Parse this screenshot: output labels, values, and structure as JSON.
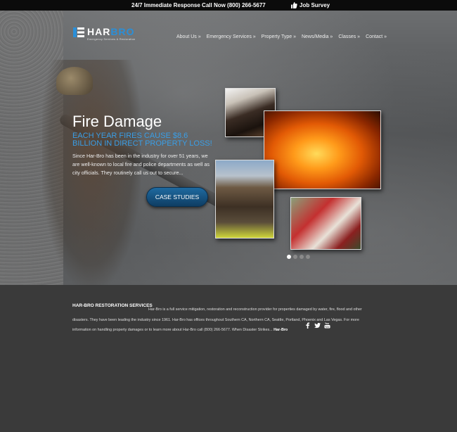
{
  "topbar": {
    "phone_text": "24/7 Immediate Response Call Now (800) 266-5677",
    "survey_label": "Job Survey",
    "survey_icon": "thumbs-up-icon"
  },
  "logo": {
    "text_a": "HAR",
    "text_b": "BRO",
    "tagline": "Emergency Services & Restoration"
  },
  "nav": {
    "items": [
      "About Us »",
      "Emergency Services »",
      "Property Type »",
      "News/Media »",
      "Classes »",
      "Contact »"
    ]
  },
  "hero": {
    "title": "Fire Damage",
    "subtitle": "EACH YEAR FIRES CAUSE $8.6 BILLION IN DIRECT PROPERTY LOSS!",
    "description": "Since Har-Bro has been in the industry for over 51 years, we are well-known to local fire and police departments as well as city officials.  They routinely call us out to secure...",
    "button_label": "CASE STUDIES",
    "slides_total": 4,
    "active_slide": 1
  },
  "footer": {
    "heading": "HAR-BRO RESTORATION SERVICES",
    "body": "Har-Bro is a full service mitigation, restoration and reconstruction provider for properties damaged by water, fire, flood and other disasters. They have been leading the industry since 1961. Har-Bro has offices throughout Southern CA, Northern CA, Seattle, Portland, Phoenix and Las Vegas. For more information on handling property damages or to learn more about Har-Bro call (800) 266-5677. When Disaster Strikes...",
    "brand": "Har-Bro",
    "social_icons": [
      "facebook-icon",
      "twitter-icon",
      "youtube-icon"
    ]
  },
  "colors": {
    "accent": "#2a8fd8",
    "button": "#1f6aa0",
    "topbar": "#0b0b0b",
    "footer_bg": "#3a3a3a"
  }
}
